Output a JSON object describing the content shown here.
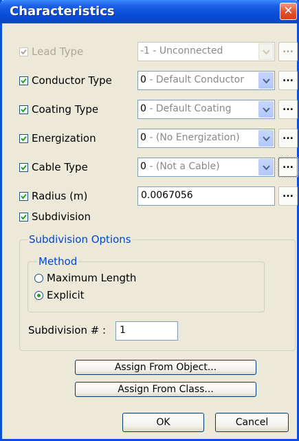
{
  "window": {
    "title": "Characteristics",
    "close_glyph": "✕"
  },
  "rows": [
    {
      "id": "lead",
      "label": "Lead Type",
      "checked": true,
      "enabled": false,
      "value_prefix": "-1",
      "value_rest": " - Unconnected"
    },
    {
      "id": "conductor",
      "label": "Conductor Type",
      "checked": true,
      "enabled": true,
      "value_prefix": "0",
      "value_rest": " - Default Conductor"
    },
    {
      "id": "coating",
      "label": "Coating Type",
      "checked": true,
      "enabled": true,
      "value_prefix": "0",
      "value_rest": " - Default Coating"
    },
    {
      "id": "energization",
      "label": "Energization",
      "checked": true,
      "enabled": true,
      "value_prefix": "0",
      "value_rest": " - (No Energization)"
    },
    {
      "id": "cable",
      "label": "Cable Type",
      "checked": true,
      "enabled": true,
      "value_prefix": "0",
      "value_rest": " - (Not a Cable)"
    }
  ],
  "radius": {
    "label": "Radius (m)",
    "checked": true,
    "value": "0.0067056"
  },
  "more_glyph": "...",
  "subdivision": {
    "label": "Subdivision",
    "checked": true
  },
  "subdivision_options": {
    "title": "Subdivision Options",
    "method_title": "Method",
    "options": [
      {
        "label": "Maximum Length",
        "selected": false
      },
      {
        "label": "Explicit",
        "selected": true
      }
    ],
    "count_label": "Subdivision # :",
    "count_value": "1"
  },
  "buttons": {
    "assign_object": "Assign From Object...",
    "assign_class": "Assign From Class...",
    "ok": "OK",
    "cancel": "Cancel"
  },
  "colors": {
    "title_blue": "#0a4ed8",
    "close_red": "#e2512c",
    "group_label": "#0046d5"
  }
}
